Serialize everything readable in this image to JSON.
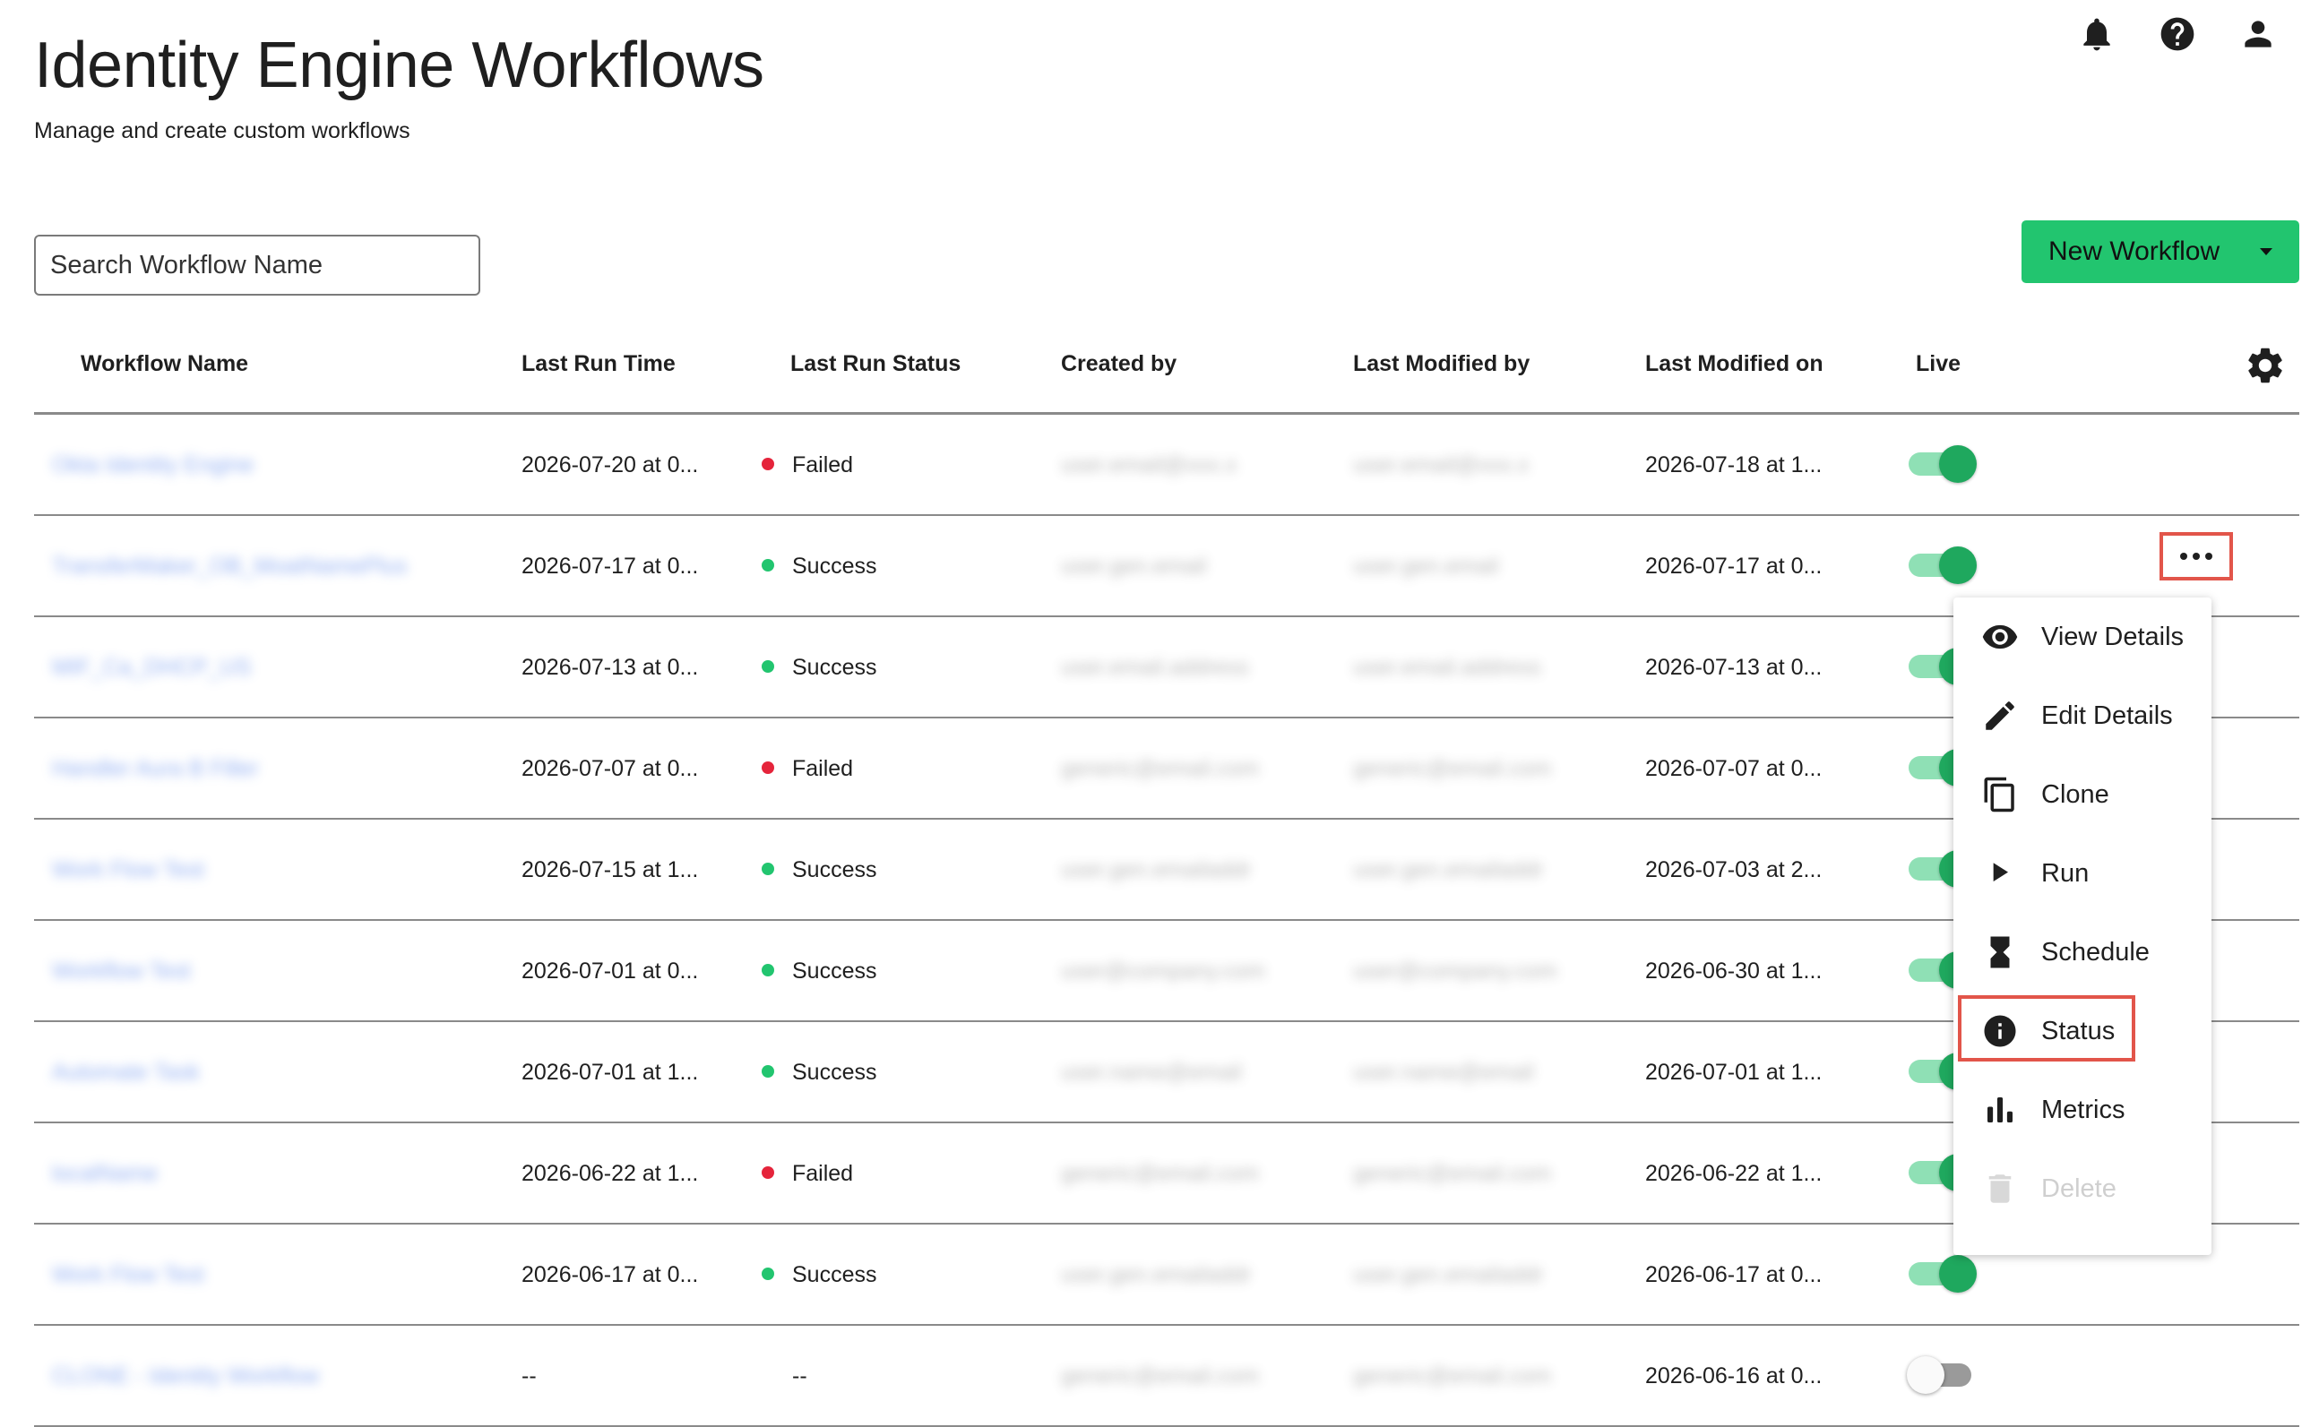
{
  "header": {
    "title": "Identity Engine Workflows",
    "subtitle": "Manage and create custom workflows",
    "icons": [
      "bell-icon",
      "help-icon",
      "account-icon"
    ]
  },
  "search": {
    "placeholder": "Search Workflow Name",
    "value": ""
  },
  "new_workflow": {
    "label": "New Workflow"
  },
  "table": {
    "columns": [
      "Workflow Name",
      "Last Run Time",
      "Last Run Status",
      "Created by",
      "Last Modified by",
      "Last Modified on",
      "Live"
    ],
    "rows": [
      {
        "name": "Okta Identity Engine",
        "last_run_time": "2026-07-20 at 0...",
        "status": "Failed",
        "created_by": "user.email@xxx.x",
        "modified_by": "user.email@xxx.x",
        "modified_on": "2026-07-18 at 1...",
        "live": true
      },
      {
        "name": "TransferMaker_OB_MoatNamePlus",
        "last_run_time": "2026-07-17 at 0...",
        "status": "Success",
        "created_by": "user.gen.email",
        "modified_by": "user.gen.email",
        "modified_on": "2026-07-17 at 0...",
        "live": true
      },
      {
        "name": "MIF_Ca_DHCP_US",
        "last_run_time": "2026-07-13 at 0...",
        "status": "Success",
        "created_by": "user.email.address",
        "modified_by": "user.email.address",
        "modified_on": "2026-07-13 at 0...",
        "live": true
      },
      {
        "name": "Handler Aura B Filler",
        "last_run_time": "2026-07-07 at 0...",
        "status": "Failed",
        "created_by": "generic@email.com",
        "modified_by": "generic@email.com",
        "modified_on": "2026-07-07 at 0...",
        "live": true
      },
      {
        "name": "Work Flow Test",
        "last_run_time": "2026-07-15 at 1...",
        "status": "Success",
        "created_by": "user.gen.emailaddr",
        "modified_by": "user.gen.emailaddr",
        "modified_on": "2026-07-03 at 2...",
        "live": true
      },
      {
        "name": "Workflow Test",
        "last_run_time": "2026-07-01 at 0...",
        "status": "Success",
        "created_by": "user@company.com",
        "modified_by": "user@company.com",
        "modified_on": "2026-06-30 at 1...",
        "live": true
      },
      {
        "name": "Automate Task",
        "last_run_time": "2026-07-01 at 1...",
        "status": "Success",
        "created_by": "user.name@email",
        "modified_by": "user.name@email",
        "modified_on": "2026-07-01 at 1...",
        "live": true
      },
      {
        "name": "localName",
        "last_run_time": "2026-06-22 at 1...",
        "status": "Failed",
        "created_by": "generic@email.com",
        "modified_by": "generic@email.com",
        "modified_on": "2026-06-22 at 1...",
        "live": true
      },
      {
        "name": "Work Flow Test",
        "last_run_time": "2026-06-17 at 0...",
        "status": "Success",
        "created_by": "user.gen.emailaddr",
        "modified_by": "user.gen.emailaddr",
        "modified_on": "2026-06-17 at 0...",
        "live": true
      },
      {
        "name": "CLONE - Identity Workflow",
        "last_run_time": "--",
        "status": "--",
        "created_by": "generic@email.com",
        "modified_by": "generic@email.com",
        "modified_on": "2026-06-16 at 0...",
        "live": false
      }
    ]
  },
  "action_menu": {
    "items": [
      {
        "label": "View Details",
        "icon": "eye-icon",
        "enabled": true
      },
      {
        "label": "Edit Details",
        "icon": "pencil-icon",
        "enabled": true
      },
      {
        "label": "Clone",
        "icon": "copy-icon",
        "enabled": true
      },
      {
        "label": "Run",
        "icon": "play-icon",
        "enabled": true
      },
      {
        "label": "Schedule",
        "icon": "hourglass-icon",
        "enabled": true
      },
      {
        "label": "Status",
        "icon": "info-icon",
        "enabled": true
      },
      {
        "label": "Metrics",
        "icon": "bar-chart-icon",
        "enabled": true
      },
      {
        "label": "Delete",
        "icon": "trash-icon",
        "enabled": false
      }
    ]
  },
  "colors": {
    "accent": "#22c56f",
    "failed": "#e5243b",
    "success": "#22c56f",
    "highlight": "#e2554a"
  }
}
